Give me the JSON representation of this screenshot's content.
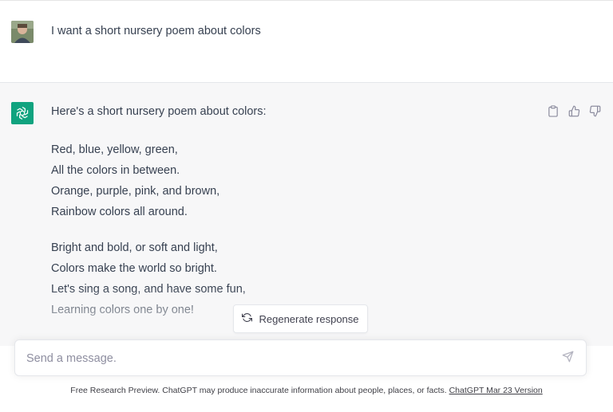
{
  "user": {
    "message": "I want a short nursery poem about colors"
  },
  "assistant": {
    "intro": "Here's a short nursery poem about colors:",
    "stanzas": [
      [
        "Red, blue, yellow, green,",
        "All the colors in between.",
        "Orange, purple, pink, and brown,",
        "Rainbow colors all around."
      ],
      [
        "Bright and bold, or soft and light,",
        "Colors make the world so bright.",
        "Let's sing a song, and have some fun,",
        "Learning colors one by one!"
      ]
    ],
    "actions": [
      "clipboard-icon",
      "thumbs-up-icon",
      "thumbs-down-icon"
    ]
  },
  "regenerate": {
    "label": "Regenerate response",
    "icon": "refresh-icon"
  },
  "composer": {
    "placeholder": "Send a message.",
    "send_icon": "send-icon"
  },
  "footer": {
    "text": "Free Research Preview. ChatGPT may produce inaccurate information about people, places, or facts.",
    "link": "ChatGPT Mar 23 Version"
  },
  "colors": {
    "brand": "#10a37f",
    "assistant_bg": "#f7f7f8",
    "text": "#374151"
  }
}
